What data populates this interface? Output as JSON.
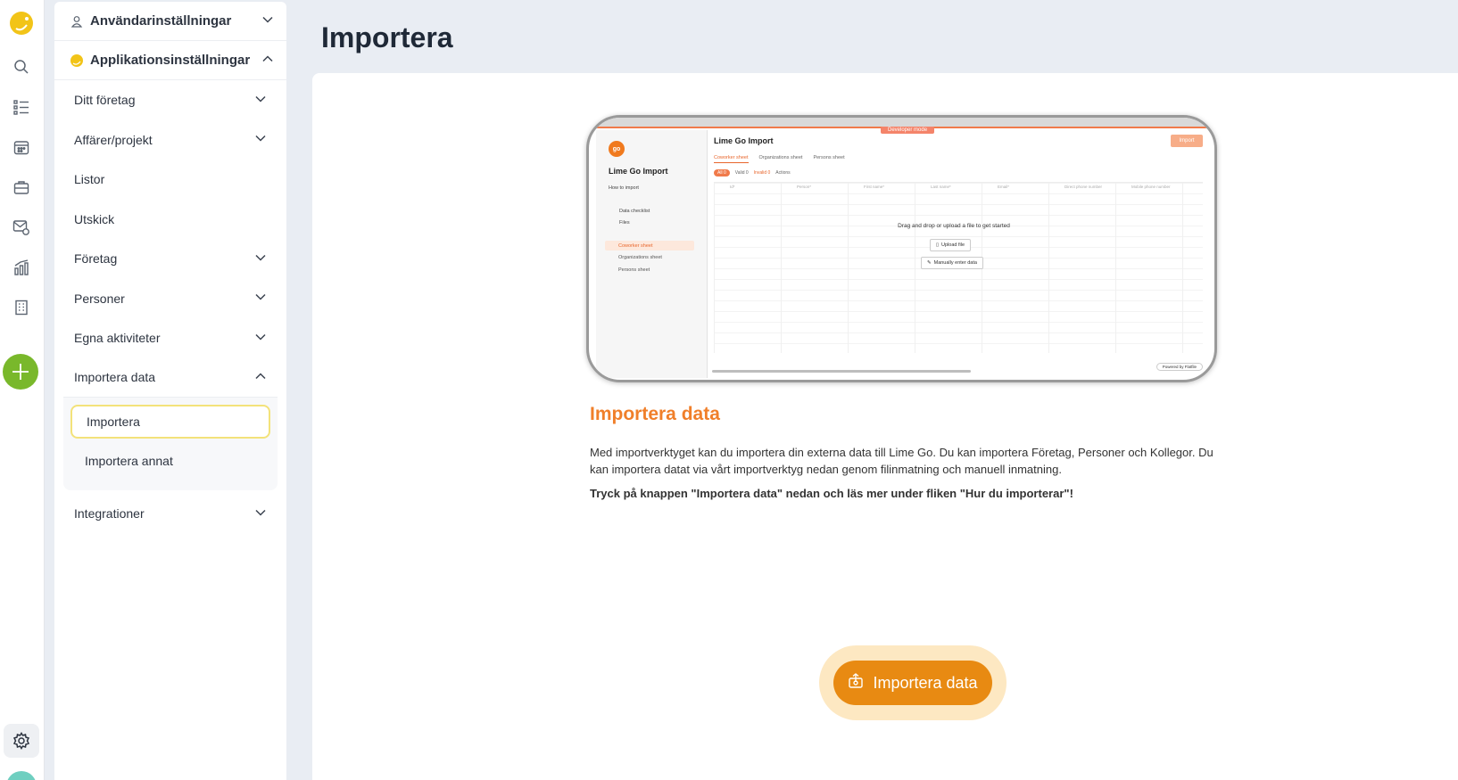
{
  "rail": {
    "icons": [
      "lime-go-logo-icon",
      "search-icon",
      "list-icon",
      "calendar-icon",
      "briefcase-icon",
      "mail-icon",
      "chart-icon",
      "building-icon",
      "add-icon",
      "settings-icon"
    ],
    "colors": {
      "add": "#79b82b",
      "logo": "#f2c418"
    }
  },
  "sidebar": {
    "user_settings": "Användarinställningar",
    "app_settings": "Applikationsinställningar",
    "items": [
      {
        "label": "Ditt företag",
        "expandable": true
      },
      {
        "label": "Affärer/projekt",
        "expandable": true
      },
      {
        "label": "Listor",
        "expandable": false
      },
      {
        "label": "Utskick",
        "expandable": false
      },
      {
        "label": "Företag",
        "expandable": true
      },
      {
        "label": "Personer",
        "expandable": true
      },
      {
        "label": "Egna aktiviteter",
        "expandable": true
      },
      {
        "label": "Importera data",
        "expandable": true,
        "open": true
      },
      {
        "label": "Integrationer",
        "expandable": true
      }
    ],
    "import_sub": [
      "Importera",
      "Importera annat"
    ],
    "active_sub": "Importera"
  },
  "main": {
    "title": "Importera",
    "mockup": {
      "dev_mode": "Developer mode",
      "side_title": "Lime Go Import",
      "logo_text": "go",
      "how_to": "How to import",
      "data_checklist": "Data checklist",
      "files": "Files",
      "sheets": [
        "Coworker sheet",
        "Organizations sheet",
        "Persons sheet"
      ],
      "main_title": "Lime Go Import",
      "import_btn": "Import",
      "tabs": [
        "Coworker sheet",
        "Organizations sheet",
        "Persons sheet"
      ],
      "filter": {
        "all": "All 0",
        "valid": "Valid 0",
        "invalid": "Invalid 0",
        "actions": "Actions"
      },
      "columns": [
        "Id*",
        "Person*",
        "First name*",
        "Last name*",
        "Email*",
        "Direct phone number",
        "Mobile phone number"
      ],
      "drop_text": "Drag and drop or upload a file to get started",
      "upload": "Upload file",
      "manual": "Manually enter data",
      "powered": "Powered by Flatfile"
    },
    "section_title": "Importera data",
    "paragraph": "Med importverktyget kan du importera din externa data till Lime Go. Du kan importera Företag, Personer och Kollegor. Du kan importera datat via vårt importverktyg nedan genom filinmatning och manuell inmatning.",
    "bold_text": "Tryck på knappen \"Importera data\" nedan och läs mer under fliken \"Hur du importerar\"!",
    "cta": "Importera data",
    "colors": {
      "accent": "#f07f2a",
      "cta": "#e88a12",
      "cta_halo": "#fde8c2"
    }
  }
}
